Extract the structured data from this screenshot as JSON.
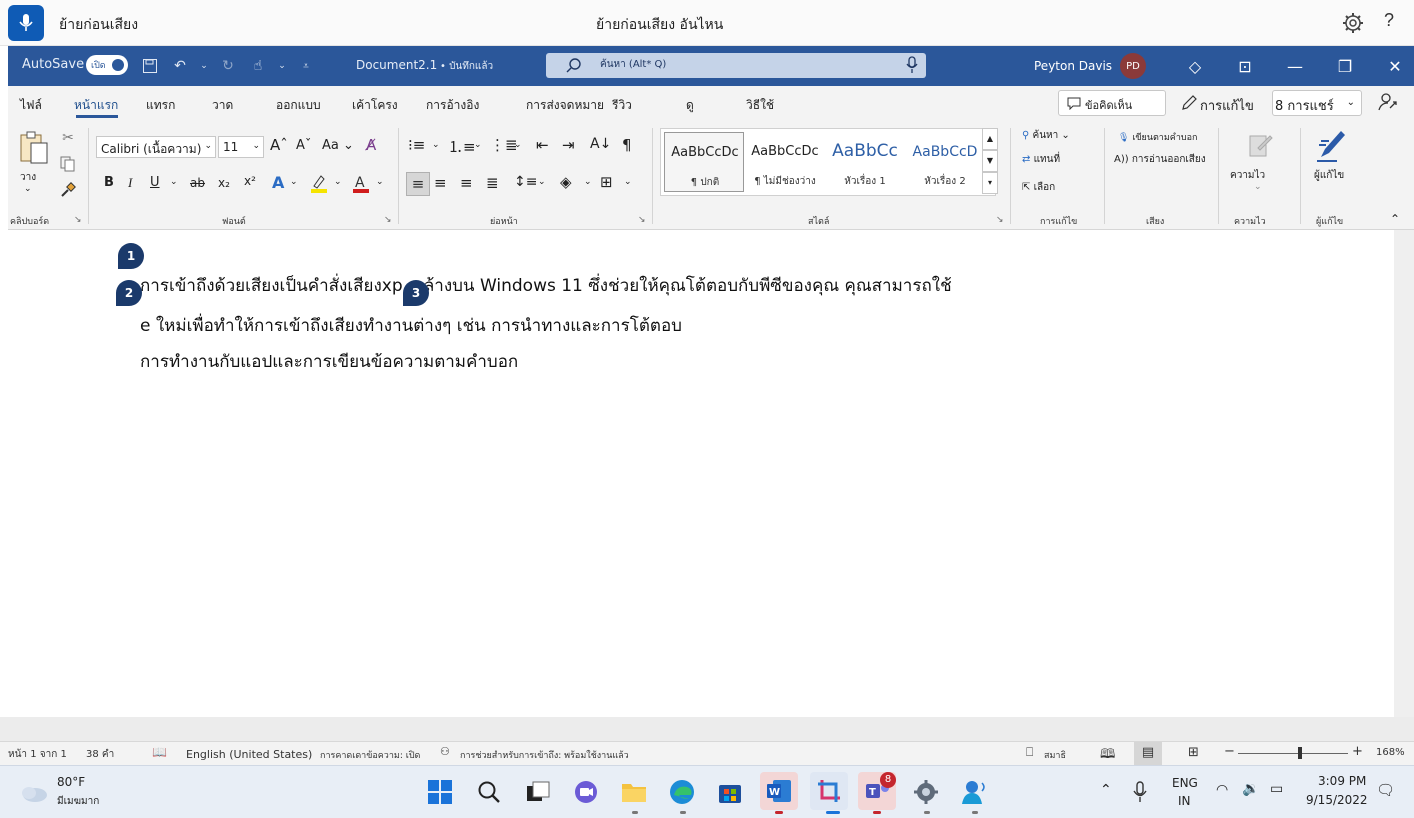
{
  "voice_access": {
    "status": "ย้ายก่อนเสียง",
    "hint": "ย้ายก่อนเสียง อันไหน"
  },
  "titlebar": {
    "autosave_label": "AutoSave",
    "autosave_state": "เปิด",
    "doc_name": "Document2.1",
    "saved_state": "• บันทึกแล้ว",
    "search_placeholder": "ค้นหา (Alt* Q)",
    "user_name": "Peyton Davis",
    "user_initials": "PD"
  },
  "tabs": [
    "ไฟล์",
    "หน้าแรก",
    "แทรก",
    "วาด",
    "ออกแบบ",
    "เค้าโครง",
    "การอ้างอิง",
    "การส่งจดหมาย",
    "รีวิว",
    "ดู",
    "วิธีใช้"
  ],
  "tab_actions": {
    "comments": "ข้อคิดเห็น",
    "editing": "การแก้ไข",
    "share": "8 การแชร์"
  },
  "ribbon": {
    "clipboard": {
      "paste": "วาง",
      "label": "คลิปบอร์ด"
    },
    "font": {
      "name": "Calibri (เนื้อความ)",
      "size": "11",
      "change_case": "Aa",
      "label": "ฟอนต์"
    },
    "paragraph": {
      "label": "ย่อหน้า"
    },
    "styles": {
      "items": [
        {
          "sample": "AaBbCcDc",
          "name": "¶ ปกติ"
        },
        {
          "sample": "AaBbCcDc",
          "name": "¶ ไม่มีช่องว่าง"
        },
        {
          "sample": "AaBbCc",
          "name": "หัวเรื่อง 1"
        },
        {
          "sample": "AaBbCcD",
          "name": "หัวเรื่อง 2"
        }
      ],
      "label": "สไตล์"
    },
    "editing": {
      "find": "ค้นหา",
      "replace": "แทนที่",
      "select": "เลือก",
      "label": "การแก้ไข"
    },
    "voice": {
      "dictate": "เขียนตามคำบอก",
      "read_aloud": "A)) การอ่านออกเสียง",
      "label": "เสียง"
    },
    "sensitivity": {
      "button": "ความไว",
      "label": "ความไว"
    },
    "editor": {
      "button": "ผู้แก้ไข",
      "label": "ผู้แก้ไข"
    }
  },
  "document": {
    "line1": "การเข้าถึงด้วยเสียงเป็นคำสั่งเสียงxp  o ล้างบน Windows 11 ซึ่งช่วยให้คุณโต้ตอบกับพีซีของคุณ คุณสามารถใช้",
    "line2": "e ใหม่เพื่อทำให้การเข้าถึงเสียงทำงานต่างๆ เช่น การนำทางและการโต้ตอบ",
    "line3": "การทำงานกับแอปและการเขียนข้อความตามคำบอก",
    "badges": [
      "1",
      "2",
      "3"
    ]
  },
  "statusbar": {
    "page": "หน้า 1 จาก 1",
    "words": "38 คำ",
    "language": "English (United States)",
    "predictions": "การคาดเดาข้อความ: เปิด",
    "accessibility": "การช่วยสำหรับการเข้าถึง: พร้อมใช้งานแล้ว",
    "focus": "สมาธิ",
    "zoom": "168%",
    "zoom_level": 0.56
  },
  "taskbar": {
    "weather_temp": "80°F",
    "weather_desc": "มีเมฆมาก",
    "teams_badge": "8",
    "lang_top": "ENG",
    "lang_bottom": "IN",
    "time": "3:09 PM",
    "date": "9/15/2022"
  },
  "colors": {
    "word_blue": "#2b579a",
    "voice_blue": "#0f5bb5",
    "badge_navy": "#1b3a6b"
  }
}
